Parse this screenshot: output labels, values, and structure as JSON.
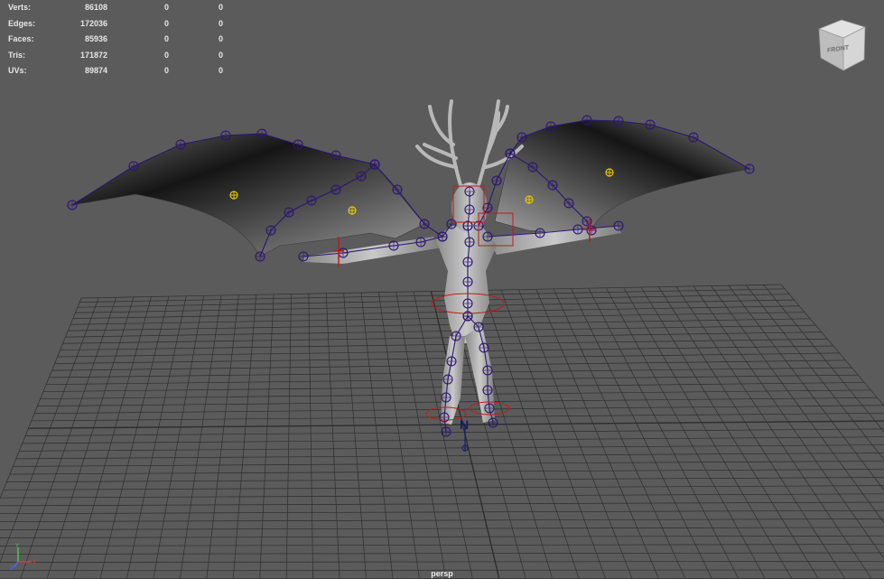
{
  "viewport": {
    "camera_label": "persp",
    "view_cube_face": "FRONT",
    "background_color": "#5b5b5b",
    "grid_color": "#2e2e2e",
    "rig_color": "#2a1770",
    "control_color": "#c01b1b",
    "light_color": "#e8c800"
  },
  "hud": {
    "rows": [
      {
        "label": "Verts:",
        "value": "86108",
        "sel": "0",
        "sel2": "0"
      },
      {
        "label": "Edges:",
        "value": "172036",
        "sel": "0",
        "sel2": "0"
      },
      {
        "label": "Faces:",
        "value": "85936",
        "sel": "0",
        "sel2": "0"
      },
      {
        "label": "Tris:",
        "value": "171872",
        "sel": "0",
        "sel2": "0"
      },
      {
        "label": "UVs:",
        "value": "89874",
        "sel": "0",
        "sel2": "0"
      }
    ]
  },
  "axis_gizmo": {
    "y": "Y",
    "x": "X",
    "z": "Z"
  },
  "gizmo_letter": "N"
}
